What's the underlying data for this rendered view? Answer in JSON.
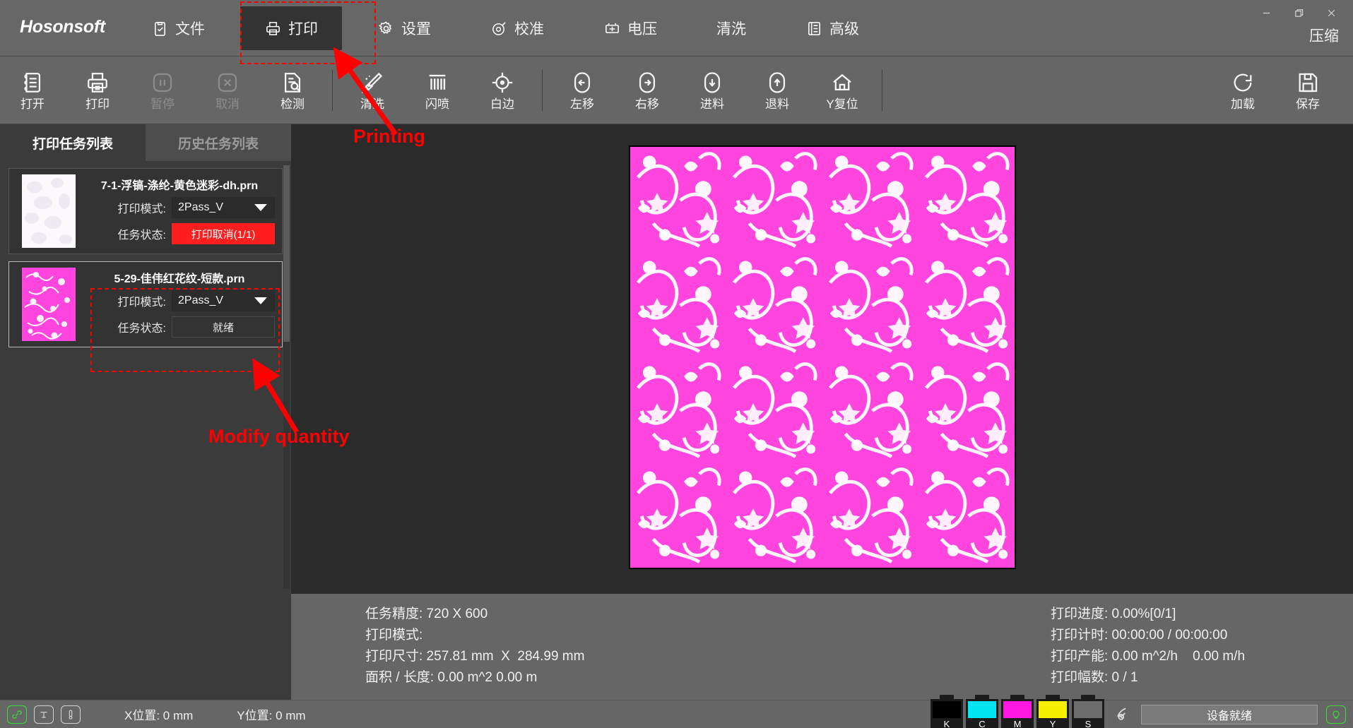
{
  "app": {
    "brand": "Hosonsoft"
  },
  "titlebar": {
    "menu": [
      {
        "label": "文件",
        "icon": "clipboard-check-icon",
        "active": false
      },
      {
        "label": "打印",
        "icon": "printer-icon",
        "active": true
      },
      {
        "label": "设置",
        "icon": "gear-icon",
        "active": false
      },
      {
        "label": "校准",
        "icon": "target-icon",
        "active": false
      },
      {
        "label": "电压",
        "icon": "battery-icon",
        "active": false
      },
      {
        "label": "清洗",
        "icon": "none",
        "active": false
      },
      {
        "label": "高级",
        "icon": "list-panel-icon",
        "active": false
      }
    ],
    "compress_label": "压缩",
    "window_controls": {
      "minimize": "minimize-icon",
      "restore": "restore-icon",
      "close": "close-icon"
    }
  },
  "toolbar": {
    "items": [
      {
        "label": "打开",
        "icon": "open-file-icon",
        "disabled": false
      },
      {
        "label": "打印",
        "icon": "printer-icon",
        "disabled": false
      },
      {
        "label": "暂停",
        "icon": "pause-icon",
        "disabled": true
      },
      {
        "label": "取消",
        "icon": "cancel-icon",
        "disabled": true
      },
      {
        "label": "检测",
        "icon": "document-search-icon",
        "disabled": false
      },
      {
        "label": "清洗",
        "icon": "brush-clean-icon",
        "disabled": false
      },
      {
        "label": "闪喷",
        "icon": "grid-spray-icon",
        "disabled": false
      },
      {
        "label": "白边",
        "icon": "crosshair-icon",
        "disabled": false
      },
      {
        "label": "左移",
        "icon": "arrow-left-icon",
        "disabled": false
      },
      {
        "label": "右移",
        "icon": "arrow-right-icon",
        "disabled": false
      },
      {
        "label": "进料",
        "icon": "arrow-down-icon",
        "disabled": false
      },
      {
        "label": "退料",
        "icon": "arrow-up-icon",
        "disabled": false
      },
      {
        "label": "Y复位",
        "icon": "home-icon",
        "disabled": false
      }
    ],
    "right_items": [
      {
        "label": "加载",
        "icon": "refresh-icon",
        "disabled": false
      },
      {
        "label": "保存",
        "icon": "save-disk-icon",
        "disabled": false
      }
    ]
  },
  "left_panel": {
    "tabs": [
      {
        "label": "打印任务列表",
        "active": true
      },
      {
        "label": "历史任务列表",
        "active": false
      }
    ],
    "jobs": [
      {
        "name": "7-1-浮镐-涤纶-黄色迷彩-dh.prn",
        "mode_label": "打印模式:",
        "mode_value": "2Pass_V",
        "status_label": "任务状态:",
        "status_value": "打印取消(1/1)",
        "status_kind": "cancel",
        "selected": false
      },
      {
        "name": "5-29-佳伟红花纹-短款.prn",
        "mode_label": "打印模式:",
        "mode_value": "2Pass_V",
        "status_label": "任务状态:",
        "status_value": "就绪",
        "status_kind": "ready",
        "selected": true
      }
    ]
  },
  "info": {
    "left": [
      "任务精度: 720 X 600",
      "打印模式:",
      "打印尺寸: 257.81 mm  X  284.99 mm",
      "面积 / 长度: 0.00 m^2 0.00 m"
    ],
    "right": [
      "打印进度: 0.00%[0/1]",
      "打印计时: 00:00:00 / 00:00:00",
      "打印产能: 0.00 m^2/h    0.00 m/h",
      "打印幅数: 0 / 1"
    ]
  },
  "statusbar": {
    "icons": [
      {
        "name": "link-icon",
        "state": "green"
      },
      {
        "name": "nozzle-icon",
        "state": "normal"
      },
      {
        "name": "thermometer-icon",
        "state": "normal"
      }
    ],
    "x_position": "X位置: 0 mm",
    "y_position": "Y位置: 0 mm",
    "inks": [
      {
        "name": "K",
        "color": "#000000"
      },
      {
        "name": "C",
        "color": "#00e5f0"
      },
      {
        "name": "M",
        "color": "#ff18e0"
      },
      {
        "name": "Y",
        "color": "#f5ef00"
      },
      {
        "name": "S",
        "color": "#6d6d6d"
      }
    ],
    "waste_icon": "waste-ink-icon",
    "device_status": "设备就绪",
    "lamp_icon": "lamp-icon"
  },
  "annotations": [
    {
      "text": "Printing",
      "target": "print-menu-item"
    },
    {
      "text": "Modify quantity",
      "target": "job-status-button"
    }
  ],
  "colors": {
    "accent_red": "#ff0000",
    "status_cancel_bg": "#ff1e1e",
    "preview_magenta": "#ff45de",
    "titlebar_bg": "#676767",
    "panel_bg": "#3b3b3b",
    "canvas_bg": "#2b2b2b"
  }
}
